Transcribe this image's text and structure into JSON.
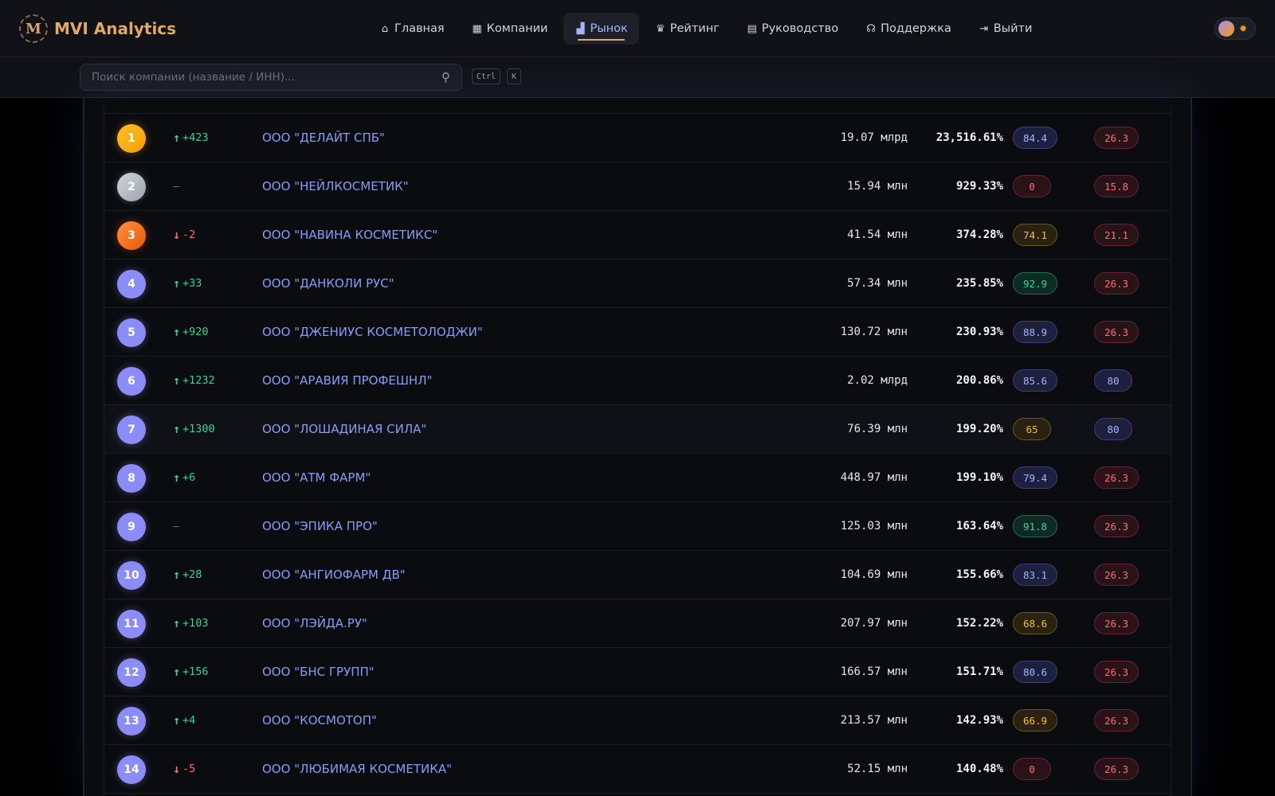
{
  "app": {
    "logo_letter": "M",
    "title": "MVI Analytics"
  },
  "nav": [
    {
      "icon": "home-icon",
      "glyph": "⌂",
      "label": "Главная",
      "active": false
    },
    {
      "icon": "building-icon",
      "glyph": "▦",
      "label": "Компании",
      "active": false
    },
    {
      "icon": "chart-icon",
      "glyph": "▟",
      "label": "Рынок",
      "active": true
    },
    {
      "icon": "trophy-icon",
      "glyph": "♛",
      "label": "Рейтинг",
      "active": false
    },
    {
      "icon": "book-icon",
      "glyph": "▤",
      "label": "Руководство",
      "active": false
    },
    {
      "icon": "headset-icon",
      "glyph": "☊",
      "label": "Поддержка",
      "active": false
    },
    {
      "icon": "logout-icon",
      "glyph": "⇥",
      "label": "Выйти",
      "active": false
    }
  ],
  "search": {
    "placeholder": "Поиск компании (название / ИНН)...",
    "value": "",
    "kbd_1": "Ctrl",
    "kbd_2": "K"
  },
  "colors": {
    "accent": "#8b9cf7",
    "brand": "#e0a86a",
    "up": "#34d399",
    "down": "#f87171"
  },
  "rows": [
    {
      "rank": "1",
      "medal": "gold",
      "dir": "up",
      "change": "+423",
      "company": "ООО \"ДЕЛАЙТ СПБ\"",
      "revenue": "19.07 млрд",
      "growth": "23,516.61%",
      "score": "84.4",
      "score_color": "blue",
      "score2": "26.3",
      "score2_color": "red"
    },
    {
      "rank": "2",
      "medal": "silver",
      "dir": "none",
      "change": "—",
      "company": "ООО \"НЕЙЛКОСМЕТИК\"",
      "revenue": "15.94 млн",
      "growth": "929.33%",
      "score": "0",
      "score_color": "red",
      "score2": "15.8",
      "score2_color": "red"
    },
    {
      "rank": "3",
      "medal": "bronze",
      "dir": "down",
      "change": "-2",
      "company": "ООО \"НАВИНА КОСМЕТИКС\"",
      "revenue": "41.54 млн",
      "growth": "374.28%",
      "score": "74.1",
      "score_color": "yellow",
      "score2": "21.1",
      "score2_color": "red"
    },
    {
      "rank": "4",
      "medal": "",
      "dir": "up",
      "change": "+33",
      "company": "ООО \"ДАНКОЛИ РУС\"",
      "revenue": "57.34 млн",
      "growth": "235.85%",
      "score": "92.9",
      "score_color": "green",
      "score2": "26.3",
      "score2_color": "red"
    },
    {
      "rank": "5",
      "medal": "",
      "dir": "up",
      "change": "+920",
      "company": "ООО \"ДЖЕНИУС КОСМЕТОЛОДЖИ\"",
      "revenue": "130.72 млн",
      "growth": "230.93%",
      "score": "88.9",
      "score_color": "blue",
      "score2": "26.3",
      "score2_color": "red"
    },
    {
      "rank": "6",
      "medal": "",
      "dir": "up",
      "change": "+1232",
      "company": "ООО \"АРАВИЯ ПРОФЕШНЛ\"",
      "revenue": "2.02 млрд",
      "growth": "200.86%",
      "score": "85.6",
      "score_color": "blue",
      "score2": "80",
      "score2_color": "blue"
    },
    {
      "rank": "7",
      "medal": "",
      "dir": "up",
      "change": "+1300",
      "company": "ООО \"ЛОШАДИНАЯ СИЛА\"",
      "revenue": "76.39 млн",
      "growth": "199.20%",
      "score": "65",
      "score_color": "yellow",
      "score2": "80",
      "score2_color": "blue",
      "highlight": true
    },
    {
      "rank": "8",
      "medal": "",
      "dir": "up",
      "change": "+6",
      "company": "ООО \"АТМ ФАРМ\"",
      "revenue": "448.97 млн",
      "growth": "199.10%",
      "score": "79.4",
      "score_color": "blue",
      "score2": "26.3",
      "score2_color": "red"
    },
    {
      "rank": "9",
      "medal": "",
      "dir": "none",
      "change": "—",
      "company": "ООО \"ЭПИКА ПРО\"",
      "revenue": "125.03 млн",
      "growth": "163.64%",
      "score": "91.8",
      "score_color": "green",
      "score2": "26.3",
      "score2_color": "red"
    },
    {
      "rank": "10",
      "medal": "",
      "dir": "up",
      "change": "+28",
      "company": "ООО \"АНГИОФАРМ ДВ\"",
      "revenue": "104.69 млн",
      "growth": "155.66%",
      "score": "83.1",
      "score_color": "blue",
      "score2": "26.3",
      "score2_color": "red"
    },
    {
      "rank": "11",
      "medal": "",
      "dir": "up",
      "change": "+103",
      "company": "ООО \"ЛЭЙДА.РУ\"",
      "revenue": "207.97 млн",
      "growth": "152.22%",
      "score": "68.6",
      "score_color": "yellow",
      "score2": "26.3",
      "score2_color": "red"
    },
    {
      "rank": "12",
      "medal": "",
      "dir": "up",
      "change": "+156",
      "company": "ООО \"БНС ГРУПП\"",
      "revenue": "166.57 млн",
      "growth": "151.71%",
      "score": "80.6",
      "score_color": "blue",
      "score2": "26.3",
      "score2_color": "red"
    },
    {
      "rank": "13",
      "medal": "",
      "dir": "up",
      "change": "+4",
      "company": "ООО \"КОСМОТОП\"",
      "revenue": "213.57 млн",
      "growth": "142.93%",
      "score": "66.9",
      "score_color": "yellow",
      "score2": "26.3",
      "score2_color": "red"
    },
    {
      "rank": "14",
      "medal": "",
      "dir": "down",
      "change": "-5",
      "company": "ООО \"ЛЮБИМАЯ КОСМЕТИКА\"",
      "revenue": "52.15 млн",
      "growth": "140.48%",
      "score": "0",
      "score_color": "red",
      "score2": "26.3",
      "score2_color": "red"
    }
  ]
}
